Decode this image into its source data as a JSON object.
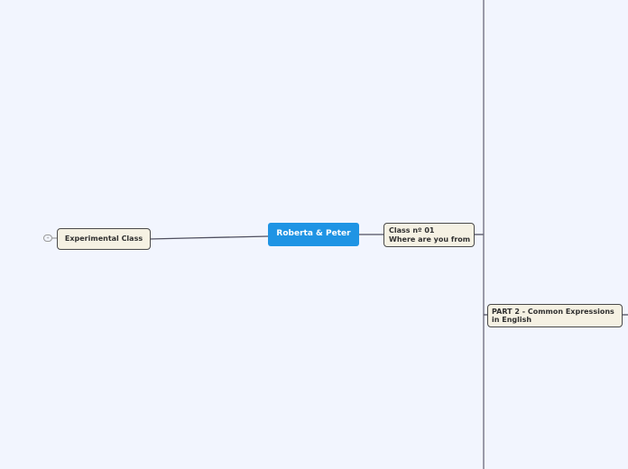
{
  "mindmap": {
    "central": {
      "label": "Roberta & Peter"
    },
    "left_branch": {
      "label": "Experimental Class",
      "collapse_badge": "+"
    },
    "right_branch": {
      "line1": "Class nº 01",
      "line2": "Where are you from",
      "child": {
        "line1": "PART 2 - Common Expressions",
        "line2": "in English"
      }
    }
  },
  "colors": {
    "background": "#f2f5fe",
    "central_fill": "#1f94e4",
    "node_fill": "#f5f1e3",
    "connector": "#4f4f5f"
  }
}
